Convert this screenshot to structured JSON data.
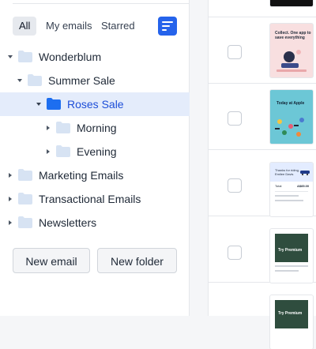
{
  "filters": {
    "all": "All",
    "my_emails": "My emails",
    "starred": "Starred",
    "active": "All",
    "sort_icon": "sort-lines-icon"
  },
  "tree": {
    "wonderblum": "Wonderblum",
    "summer_sale": "Summer Sale",
    "roses_sale": "Roses Sale",
    "morning": "Morning",
    "evening": "Evening",
    "marketing_emails": "Marketing Emails",
    "transactional_emails": "Transactional Emails",
    "newsletters": "Newsletters",
    "selected": "Roses Sale"
  },
  "actions": {
    "new_email": "New email",
    "new_folder": "New folder"
  },
  "emails": {
    "thumb_2_text": "Collect. One app to\nsave everything",
    "thumb_3_text": "Today at Apple",
    "thumb_4_text": "Thanks for riding,\nEmilee Davis",
    "thumb_4_total": "Total",
    "thumb_4_amount": "A$85.00",
    "thumb_5_text": "Try Premium",
    "thumb_6_text": "Try Premium"
  },
  "colors": {
    "accent": "#2563eb",
    "selected_bg": "#e4ecfb",
    "folder_light": "#d7e3f3",
    "folder_selected": "#1d6ef0"
  }
}
